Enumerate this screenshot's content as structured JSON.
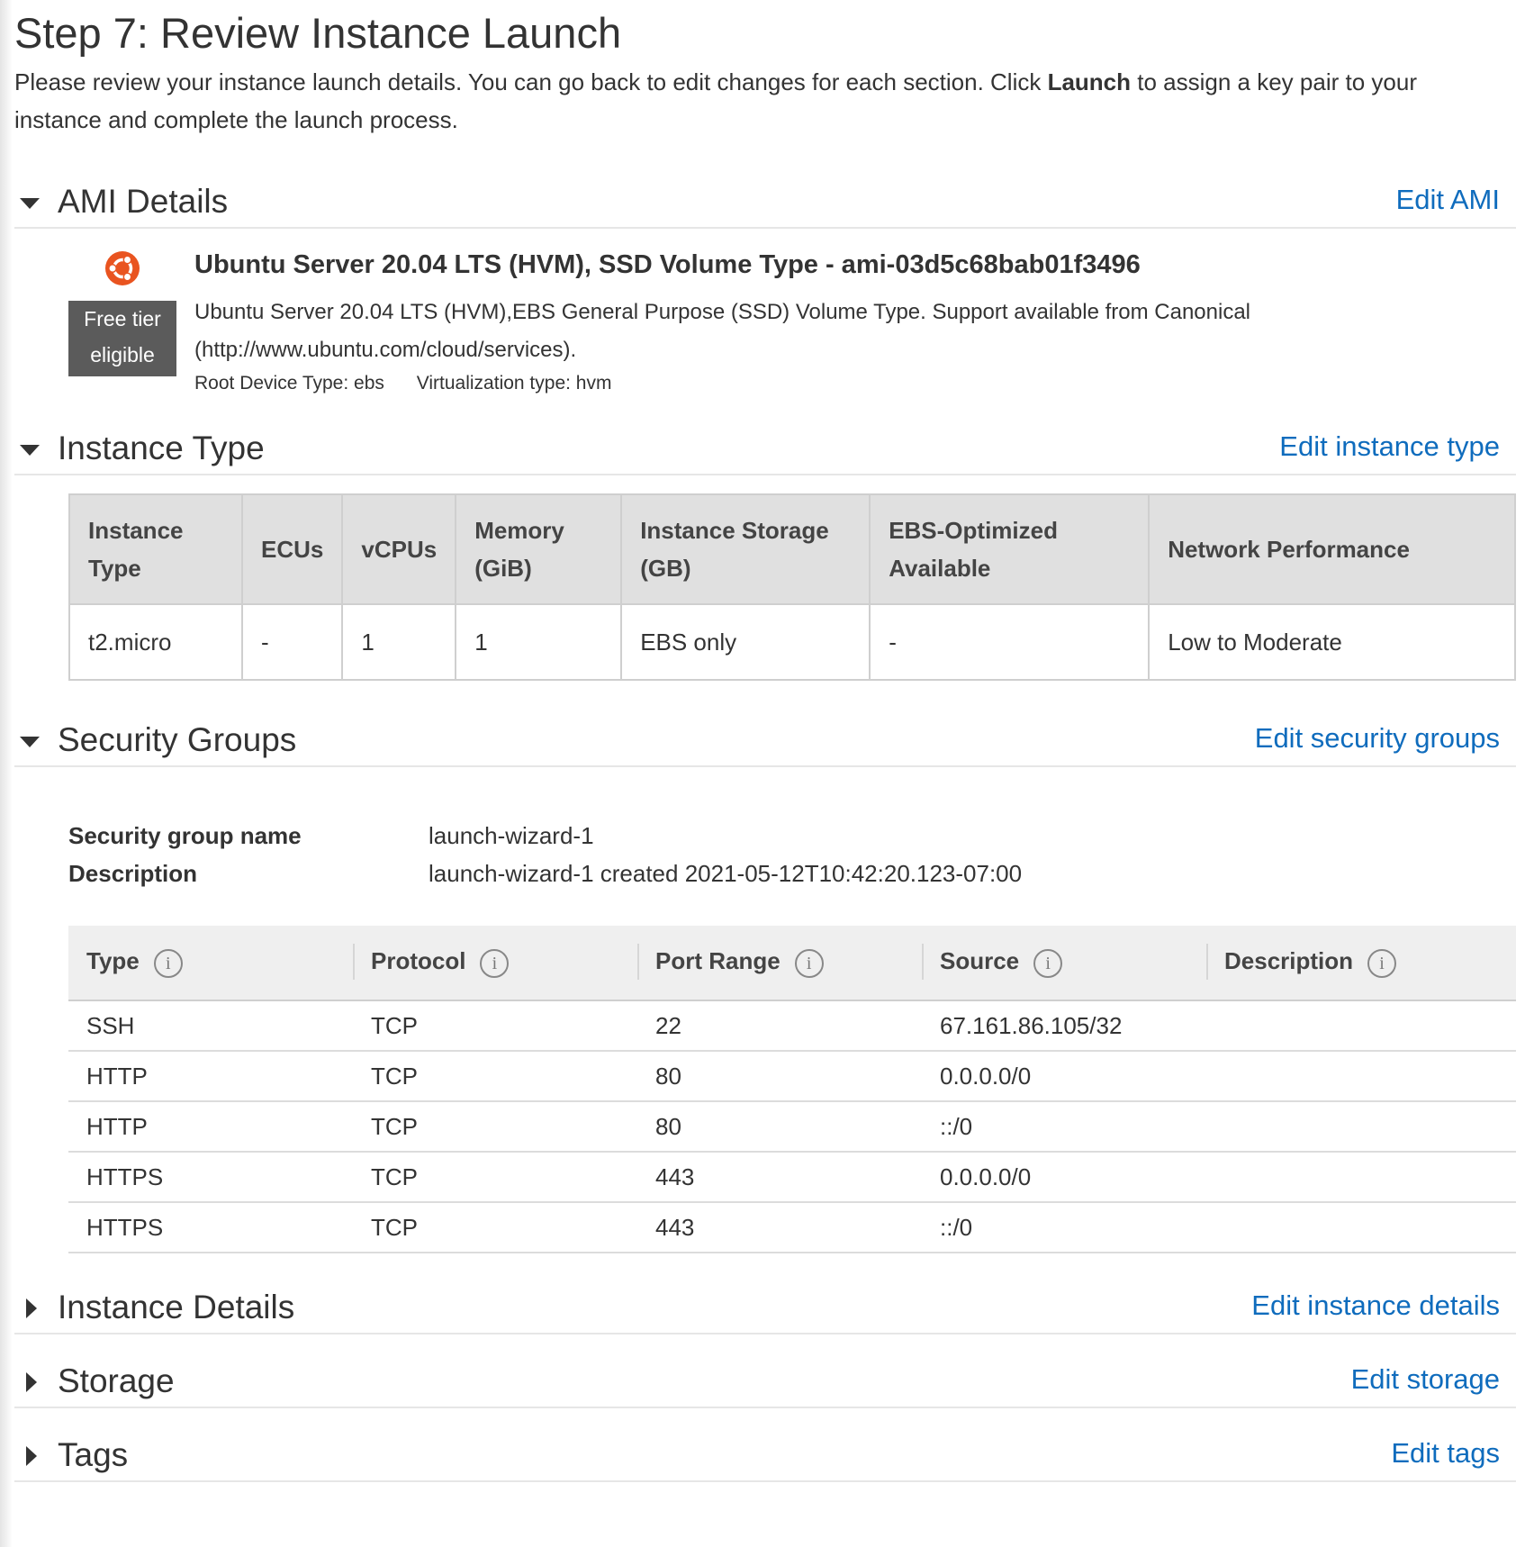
{
  "page": {
    "title": "Step 7: Review Instance Launch",
    "intro_before": "Please review your instance launch details. You can go back to edit changes for each section. Click ",
    "intro_bold": "Launch",
    "intro_after": " to assign a key pair to your instance and complete the launch process."
  },
  "ami": {
    "section_title": "AMI Details",
    "edit_label": "Edit AMI",
    "logo_icon": "ubuntu-logo-icon",
    "badge_line1": "Free tier",
    "badge_line2": "eligible",
    "name": "Ubuntu Server 20.04 LTS (HVM), SSD Volume Type - ami-03d5c68bab01f3496",
    "description": "Ubuntu Server 20.04 LTS (HVM),EBS General Purpose (SSD) Volume Type. Support available from Canonical (http://www.ubuntu.com/cloud/services).",
    "root_device": "Root Device Type: ebs",
    "virtualization": "Virtualization type: hvm"
  },
  "instance_type": {
    "section_title": "Instance Type",
    "edit_label": "Edit instance type",
    "headers": [
      "Instance Type",
      "ECUs",
      "vCPUs",
      "Memory (GiB)",
      "Instance Storage (GB)",
      "EBS-Optimized Available",
      "Network Performance"
    ],
    "row": [
      "t2.micro",
      "-",
      "1",
      "1",
      "EBS only",
      "-",
      "Low to Moderate"
    ]
  },
  "security_groups": {
    "section_title": "Security Groups",
    "edit_label": "Edit security groups",
    "name_label": "Security group name",
    "name_value": "launch-wizard-1",
    "description_label": "Description",
    "description_value": "launch-wizard-1 created 2021-05-12T10:42:20.123-07:00",
    "columns": [
      "Type",
      "Protocol",
      "Port Range",
      "Source",
      "Description"
    ],
    "rules": [
      [
        "SSH",
        "TCP",
        "22",
        "67.161.86.105/32",
        ""
      ],
      [
        "HTTP",
        "TCP",
        "80",
        "0.0.0.0/0",
        ""
      ],
      [
        "HTTP",
        "TCP",
        "80",
        "::/0",
        ""
      ],
      [
        "HTTPS",
        "TCP",
        "443",
        "0.0.0.0/0",
        ""
      ],
      [
        "HTTPS",
        "TCP",
        "443",
        "::/0",
        ""
      ]
    ]
  },
  "instance_details": {
    "section_title": "Instance Details",
    "edit_label": "Edit instance details"
  },
  "storage": {
    "section_title": "Storage",
    "edit_label": "Edit storage"
  },
  "tags": {
    "section_title": "Tags",
    "edit_label": "Edit tags"
  },
  "colors": {
    "link": "#0f6cbd",
    "badge_bg": "#5b5b5b",
    "ubuntu_orange": "#e95420"
  }
}
